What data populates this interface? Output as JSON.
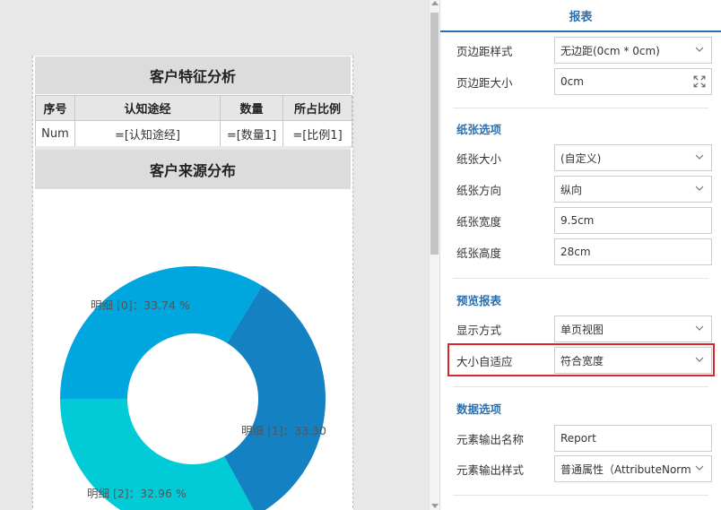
{
  "report": {
    "title1": "客户特征分析",
    "columns": [
      "序号",
      "认知途经",
      "数量",
      "所占比例"
    ],
    "row": [
      "Num",
      "=[认知途经]",
      "=[数量1]",
      "=[比例1]"
    ],
    "title2": "客户来源分布"
  },
  "chart_data": {
    "type": "pie",
    "variant": "donut",
    "categories": [
      "明细 [0]",
      "明细 [1]",
      "明细 [2]"
    ],
    "values": [
      33.74,
      33.3,
      32.96
    ],
    "labels": [
      "明细 [0]：33.74 %",
      "明细 [1]：33.30",
      "明细 [2]：32.96 %"
    ],
    "colors": [
      "#00a6de",
      "#1482c2",
      "#00cbd6"
    ]
  },
  "panel": {
    "tab": "报表",
    "margin_style_label": "页边距样式",
    "margin_style_value": "无边距(0cm * 0cm)",
    "margin_size_label": "页边距大小",
    "margin_size_value": "0cm",
    "paper_section": "纸张选项",
    "paper_size_label": "纸张大小",
    "paper_size_value": "(自定义)",
    "paper_orientation_label": "纸张方向",
    "paper_orientation_value": "纵向",
    "paper_width_label": "纸张宽度",
    "paper_width_value": "9.5cm",
    "paper_height_label": "纸张高度",
    "paper_height_value": "28cm",
    "preview_section": "预览报表",
    "display_mode_label": "显示方式",
    "display_mode_value": "单页视图",
    "auto_fit_label": "大小自适应",
    "auto_fit_value": "符合宽度",
    "data_section": "数据选项",
    "output_name_label": "元素输出名称",
    "output_name_value": "Report",
    "output_style_label": "元素输出样式",
    "output_style_value": "普通属性（AttributeNorm"
  },
  "icons": {
    "chevron": "chevron-down-icon",
    "expand": "expand-icon"
  },
  "colors": {
    "accent": "#2a6fb0",
    "highlight": "#d9252b"
  }
}
